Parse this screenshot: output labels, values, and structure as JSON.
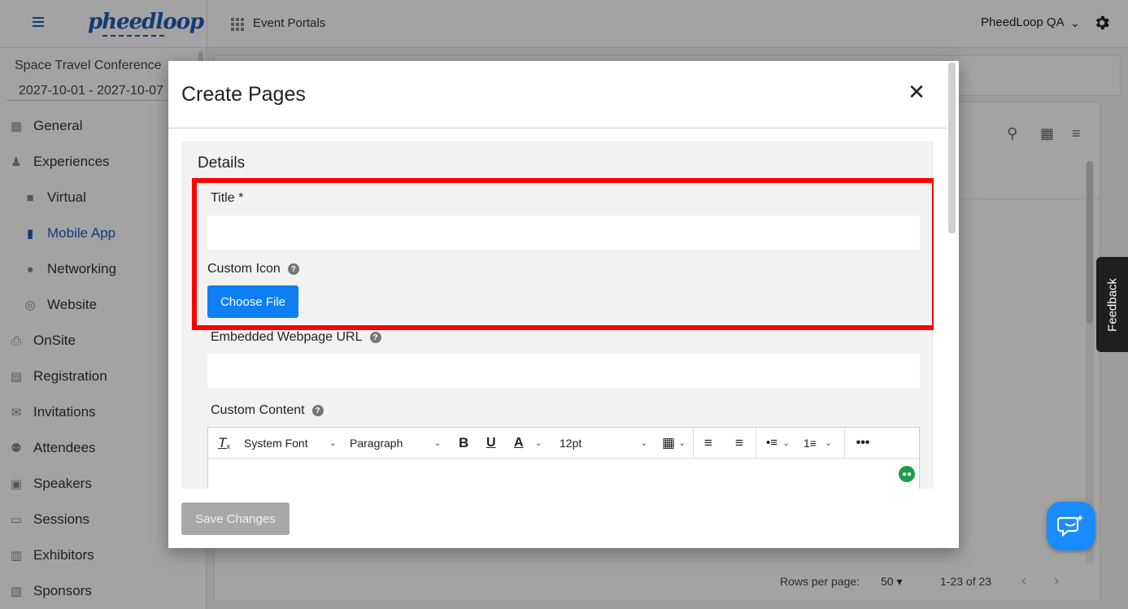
{
  "topbar": {
    "logo_text": "pheedloop",
    "portals_label": "Event Portals",
    "account_label": "PheedLoop QA"
  },
  "sidebar": {
    "conference_name": "Space Travel Conference",
    "conference_dates": "2027-10-01 - 2027-10-07",
    "items": [
      {
        "label": "General",
        "icon": "grid-icon",
        "level": "top",
        "active": false
      },
      {
        "label": "Experiences",
        "icon": "person-icon",
        "level": "top",
        "active": false
      },
      {
        "label": "Virtual",
        "icon": "video-icon",
        "level": "sub",
        "active": false
      },
      {
        "label": "Mobile App",
        "icon": "phone-icon",
        "level": "sub",
        "active": true
      },
      {
        "label": "Networking",
        "icon": "chat-bubble-icon",
        "level": "sub",
        "active": false
      },
      {
        "label": "Website",
        "icon": "globe-icon",
        "level": "sub",
        "active": false
      },
      {
        "label": "OnSite",
        "icon": "printer-icon",
        "level": "top",
        "active": false
      },
      {
        "label": "Registration",
        "icon": "cart-icon",
        "level": "top",
        "active": false
      },
      {
        "label": "Invitations",
        "icon": "mail-icon",
        "level": "top",
        "active": false
      },
      {
        "label": "Attendees",
        "icon": "people-icon",
        "level": "top",
        "active": false
      },
      {
        "label": "Speakers",
        "icon": "presenter-icon",
        "level": "top",
        "active": false
      },
      {
        "label": "Sessions",
        "icon": "laptop-icon",
        "level": "top",
        "active": false
      },
      {
        "label": "Exhibitors",
        "icon": "store-icon",
        "level": "top",
        "active": false
      },
      {
        "label": "Sponsors",
        "icon": "handshake-icon",
        "level": "top",
        "active": false
      }
    ]
  },
  "background_table": {
    "rows_per_page_label": "Rows per page:",
    "rows_per_page_value": "50",
    "range_label": "1-23 of 23"
  },
  "feedback": {
    "label": "Feedback"
  },
  "modal": {
    "title": "Create Pages",
    "section_heading": "Details",
    "title_label": "Title *",
    "title_value": "",
    "custom_icon_label": "Custom Icon",
    "choose_file_label": "Choose File",
    "embedded_url_label": "Embedded Webpage URL",
    "embedded_url_value": "",
    "custom_content_label": "Custom Content",
    "editor": {
      "font_family": "System Font",
      "block_format": "Paragraph",
      "font_size": "12pt"
    },
    "save_label": "Save Changes"
  },
  "colors": {
    "accent": "#1e5bb8",
    "primary_button": "#0d7ff2",
    "highlight_border": "#ff0000",
    "disabled_button": "#a8a8a8"
  }
}
